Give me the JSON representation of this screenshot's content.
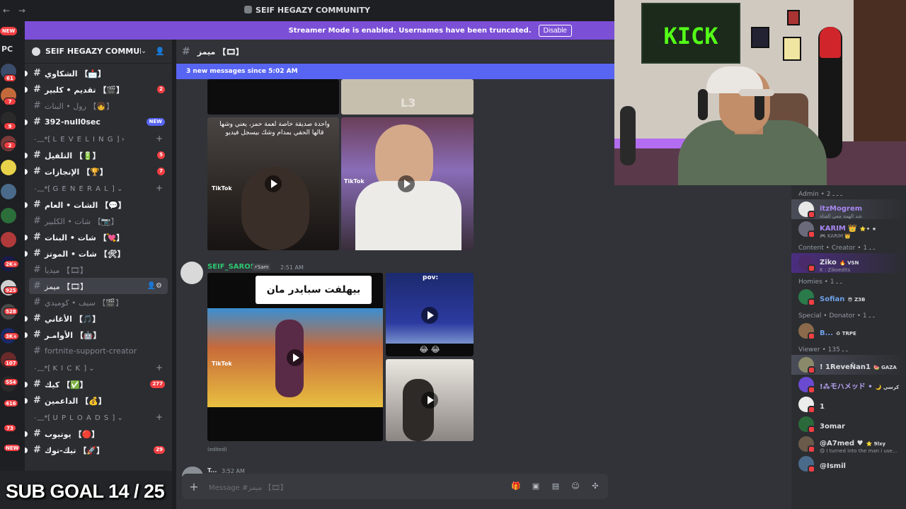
{
  "titlebar": {
    "title": "SEIF HEGAZY COMMUNITY",
    "nav": "← →"
  },
  "banner": {
    "message": "Streamer Mode is enabled. Usernames have been truncated.",
    "button": "Disable"
  },
  "rail": {
    "new_label": "NEW",
    "pc_label": "PC",
    "badges": [
      "61",
      "7",
      "9",
      "2",
      "2K+",
      "925",
      "528",
      "3K+",
      "107",
      "554",
      "416",
      "73",
      "NEW"
    ]
  },
  "sidebar": {
    "guild_name": "SEIF HEGAZY COMMUNI...",
    "items": [
      {
        "type": "channel",
        "label": "الشكاوي 【📩】",
        "unread": true
      },
      {
        "type": "channel",
        "label": "تقديم • كلبير 【🎬】",
        "unread": true,
        "badge": "2"
      },
      {
        "type": "channel",
        "label": "رول • البنات 【👧】",
        "unread": false
      },
      {
        "type": "channel",
        "label": "392-null0sec",
        "unread": true,
        "new": "NEW"
      },
      {
        "type": "category",
        "label": "۰﹏*[ L E V E L I N G ] ›"
      },
      {
        "type": "channel",
        "label": "التلفيل 【🔋】",
        "unread": true,
        "badge": "5"
      },
      {
        "type": "channel",
        "label": "الإنجازات 【🏆】",
        "unread": true,
        "badge": "7"
      },
      {
        "type": "category",
        "label": "۰﹏*[ G E N E R A L ] ⌄"
      },
      {
        "type": "channel",
        "label": "الشات • العام 【💬】",
        "unread": true
      },
      {
        "type": "channel",
        "label": "شات • الكلبير 【📷】",
        "unread": false
      },
      {
        "type": "channel",
        "label": "شات • البنات 【💘】",
        "unread": true
      },
      {
        "type": "channel",
        "label": "شات • الموتز 【🛠】",
        "unread": true
      },
      {
        "type": "channel",
        "label": "ميديا 【🎞】",
        "unread": false
      },
      {
        "type": "channel",
        "label": "ميمز 【🎞】",
        "active": true
      },
      {
        "type": "channel",
        "label": "سيف • كوميدي 【🎬】",
        "unread": false
      },
      {
        "type": "channel",
        "label": "الأغاني 【🎵】",
        "unread": true
      },
      {
        "type": "channel",
        "label": "الأوامـر 【🤖】",
        "unread": true
      },
      {
        "type": "channel",
        "label": "fortnite-support-creator",
        "unread": false
      },
      {
        "type": "category",
        "label": "۰﹏*[ K I C K ] ⌄"
      },
      {
        "type": "channel",
        "label": "كيك 【✅】",
        "unread": true,
        "badge": "277"
      },
      {
        "type": "channel",
        "label": "الداعمين 【💰】",
        "unread": true
      },
      {
        "type": "category",
        "label": "۰﹏*[ U P L O A D S ] ⌄"
      },
      {
        "type": "channel",
        "label": "يوتيوب 【🔴】",
        "unread": true
      },
      {
        "type": "channel",
        "label": "تيك-توك 【🚀】",
        "unread": true,
        "badge": "29"
      }
    ]
  },
  "chat": {
    "channel_name": "ميمز 【🎞】",
    "new_messages": "3 new messages since 5:02 AM",
    "top_caption": "واحدة صديقة خاصة لعمة حمز، يعني وشها قالها الحقي بمدام وشك بيسجل فيديو",
    "tiktok_label": "TikTok",
    "message_author": "SEIF_SAROS",
    "message_tag": "⚡Sam",
    "message_time": "2:51 AM",
    "meme_caption": "بيهلفت سبايدر مان",
    "pov_label": "pov:",
    "edited_label": "(edited)",
    "next_author": "T...",
    "next_time": "3:52 AM",
    "composer_placeholder": "Message #ميمز 【🎞】"
  },
  "members": {
    "groups": [
      {
        "title": "Admin • ـ ـ ـ 2",
        "members": [
          {
            "name": "itzMogrem",
            "sub": "شد الهمة معي القناة",
            "color": "#a987f0",
            "highlight": true
          },
          {
            "name": "KARIM 👑",
            "sub": "🎮 KARIM 👑",
            "color": "#a987f0",
            "tag": "⭐✦ ★"
          }
        ]
      },
      {
        "title": "Content • Creator • ـ ـ 1",
        "members": [
          {
            "name": "Ziko",
            "sub": "K : Zikoedits",
            "color": "#dbdee1",
            "tag": "🔥 VSN",
            "purple": true
          }
        ]
      },
      {
        "title": "Homies • ـ ـ 1",
        "members": [
          {
            "name": "Sofian",
            "sub": "",
            "color": "#6fa0e8",
            "tag": "😎 Z3B"
          }
        ]
      },
      {
        "title": "Special • Donator • ـ ـ 1",
        "members": [
          {
            "name": "B...",
            "sub": "",
            "color": "#6fa0e8",
            "tag": "♻ TRPE"
          }
        ]
      },
      {
        "title": "Viewer • ـ ـ 135",
        "members": [
          {
            "name": "! 1ReveÑan1",
            "sub": "",
            "color": "#dbdee1",
            "tag": "🍉 GAZA",
            "highlight": true
          },
          {
            "name": "!⁂モハメッド •",
            "sub": "",
            "color": "#b6a1f0",
            "tag": "🌙 كرسي"
          },
          {
            "name": "1",
            "sub": "",
            "color": "#dbdee1"
          },
          {
            "name": "3omar",
            "sub": "",
            "color": "#dbdee1"
          },
          {
            "name": "@A7med ♥",
            "sub": "😋 I turned into the man i use...",
            "color": "#dbdee1",
            "tag": "⭐ 9lxy"
          },
          {
            "name": "@Ismil",
            "sub": "",
            "color": "#dbdee1"
          }
        ]
      }
    ]
  },
  "webcam": {
    "banner_text": "KICK"
  },
  "overlay": {
    "sub_goal": "SUB GOAL 14 / 25"
  },
  "colors": {
    "accent": "#5865f2",
    "banner": "#7b4fd6",
    "kick_green": "#53fc18",
    "author_green": "#2dc770"
  }
}
